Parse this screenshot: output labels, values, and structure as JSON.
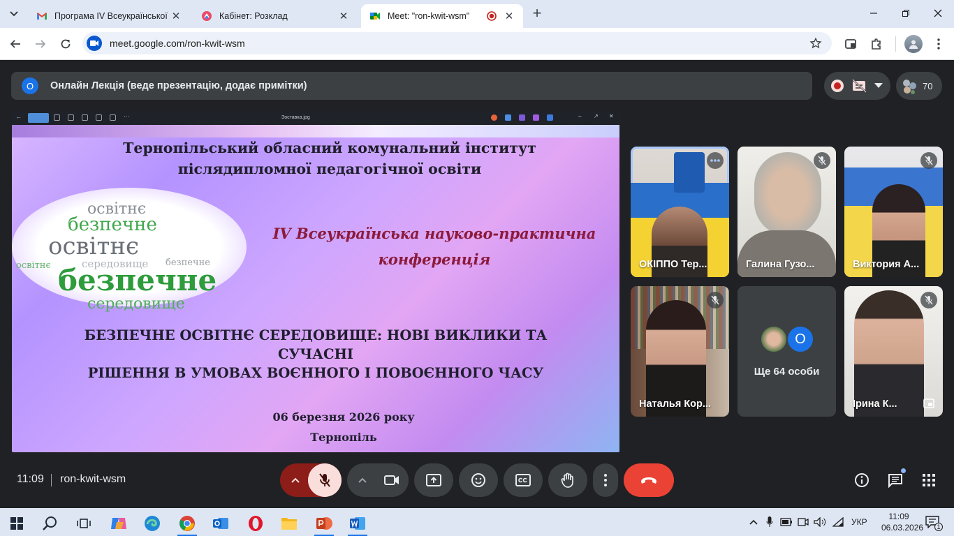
{
  "browser": {
    "tabs": [
      {
        "title": "Програма IV Всеукраїнської на",
        "favicon": "gmail-icon"
      },
      {
        "title": "Кабінет: Розклад",
        "favicon": "cabinet-icon"
      },
      {
        "title": "Meet: \"ron-kwit-wsm\"",
        "favicon": "meet-icon",
        "active": true
      }
    ],
    "url": "meet.google.com/ron-kwit-wsm"
  },
  "meet": {
    "presenter_initial": "О",
    "presenter_label": "Онлайн Лекція (веде презентацію, додає примітки)",
    "participants_count": "70",
    "viewer_filename": "Зоставка.jpg",
    "slide": {
      "institute_line1": "Тернопільський обласний комунальний інститут",
      "institute_line2": "післядипломної педагогічної освіти",
      "cloud_words": [
        "освітнє",
        "безпечне",
        "освітнє",
        "середовище",
        "безпечне",
        "середовище",
        "освітнє",
        "безпечне"
      ],
      "conference_line1": "IV Всеукраїнська науково-практична",
      "conference_line2": "конференція",
      "theme_line1": "БЕЗПЕЧНЕ ОСВІТНЄ СЕРЕДОВИЩЕ: НОВІ ВИКЛИКИ ТА СУЧАСНІ",
      "theme_line2": "РІШЕННЯ В УМОВАХ ВОЄННОГО І ПОВОЄННОГО ЧАСУ",
      "date": "06 березня 2026 року",
      "city": "Тернопіль"
    },
    "tiles": [
      {
        "name": "ОКІППО Тер...",
        "speaking": true
      },
      {
        "name": "Галина Гузо..."
      },
      {
        "name": "Виктория А..."
      },
      {
        "name": "Наталья Кор..."
      },
      {
        "name": "Ще 64 особи",
        "avatar_letter": "О"
      },
      {
        "name": "Ірина К..."
      }
    ],
    "time": "11:09",
    "meeting_code": "ron-kwit-wsm"
  },
  "taskbar": {
    "language": "УКР",
    "time": "11:09",
    "date": "06.03.2026",
    "notification_count": "1"
  },
  "colors": {
    "meet_bg": "#202124",
    "surface": "#3c4043",
    "end_call": "#ea4335",
    "mic_off_bg": "#f9dedc",
    "accent_blue": "#1a73e8"
  }
}
